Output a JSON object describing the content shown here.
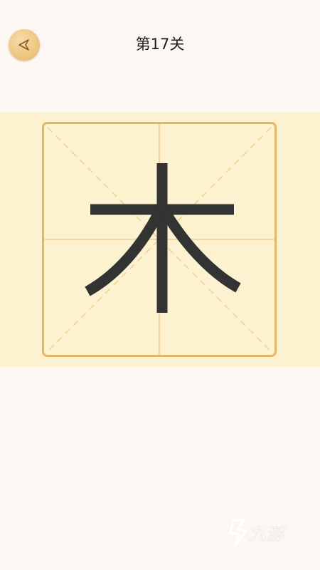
{
  "header": {
    "level_title": "第17关",
    "back_icon": "back-arrow-icon"
  },
  "board": {
    "character": "木",
    "grid_type": "米字格"
  },
  "watermark": {
    "text": "九游"
  },
  "colors": {
    "background": "#fcf7f2",
    "band": "#fdf2cf",
    "grid_border": "#e3b566",
    "guide_line": "#f0d7a6",
    "character": "#333333",
    "button_gold": "#ecc27a"
  }
}
